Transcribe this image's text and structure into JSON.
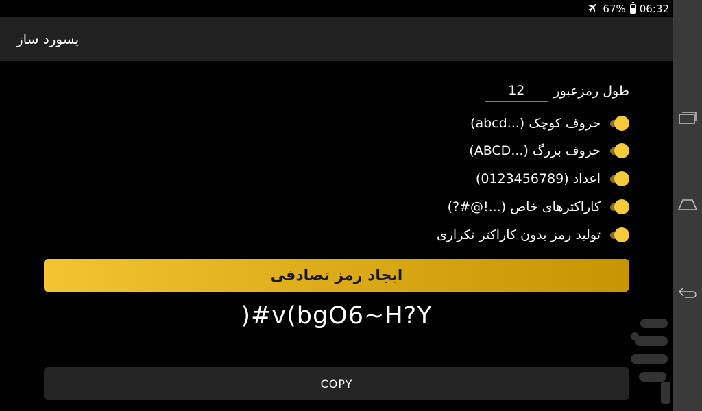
{
  "status_bar": {
    "battery": "67%",
    "time": "06:32"
  },
  "app_bar": {
    "title": "پسورد ساز"
  },
  "password_length": {
    "label": "طول رمزعبور",
    "value": "12"
  },
  "options": [
    {
      "label": "حروف کوچک (...abcd)",
      "checked": true
    },
    {
      "label": "حروف بزرگ (...ABCD)",
      "checked": true
    },
    {
      "label": "اعداد (0123456789)",
      "checked": true
    },
    {
      "label": "کاراکترهای خاص (...!@#?)",
      "checked": true
    },
    {
      "label": "تولید رمز بدون کاراکتر تکراری",
      "checked": true
    }
  ],
  "generate_button": {
    "label": "ایجاد رمز تصادفی"
  },
  "generated_password": ")#v(bgO6~H?Y",
  "copy_button": {
    "label": "COPY"
  },
  "colors": {
    "accent": "#f5cb3b",
    "input_underline": "#2a9d94",
    "app_bar": "#212121"
  },
  "icons": [
    "airplane-mode-icon",
    "battery-icon",
    "recent-apps-icon",
    "home-icon",
    "back-icon"
  ]
}
